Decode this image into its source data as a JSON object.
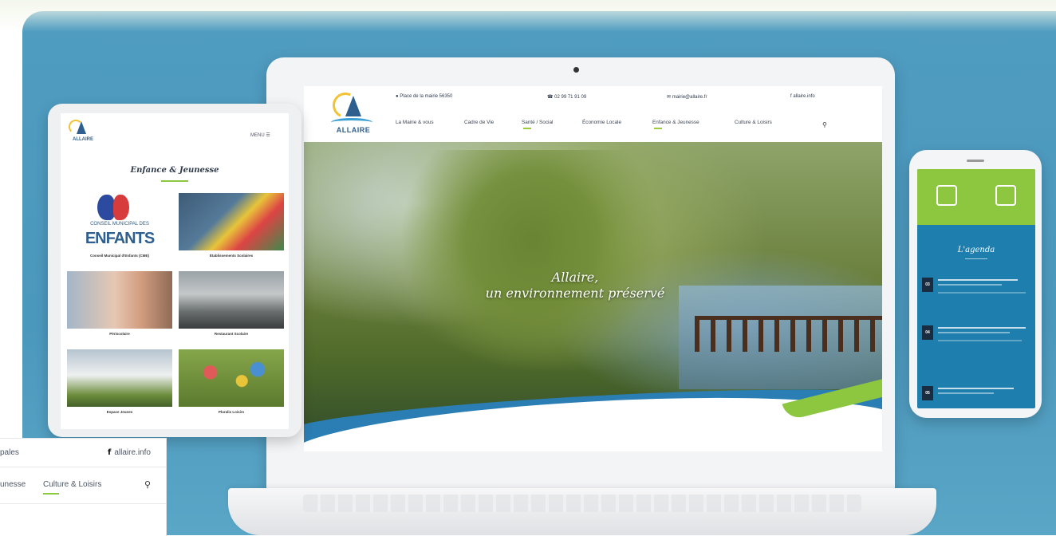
{
  "colors": {
    "backdrop": "#4f9cc0",
    "accent_green": "#8dc63f",
    "brand_blue": "#2e5f8e"
  },
  "laptop": {
    "topbar": {
      "address": "Place de la mairie 56350",
      "phone": "02 99 71 91 09",
      "email": "mairie@allaire.fr",
      "facebook": "allaire.info"
    },
    "nav": [
      "La Mairie & vous",
      "Cadre de Vie",
      "Santé / Social",
      "Économie Locale",
      "Enfance & Jeunesse",
      "Culture & Loisirs"
    ],
    "logo_text": "ALLAIRE",
    "hero_line1": "Allaire,",
    "hero_line2": "un environnement préservé"
  },
  "tablet": {
    "menu_label": "MENU",
    "title": "Enfance & Jeunesse",
    "enfants_pre": "CONSEIL MUNICIPAL DES",
    "enfants_big": "ENFANTS",
    "tiles": [
      "Conseil Municipal d'Enfants (CME)",
      "Établissements Scolaires",
      "Périscolaire",
      "Restaurant Scolaire",
      "Espace Jeunes",
      "Pluralis Loisirs"
    ]
  },
  "phone": {
    "agenda_title": "L'agenda",
    "dates": [
      "03",
      "04",
      "05"
    ]
  },
  "overlay": {
    "row1_left": "pales",
    "facebook_glyph": "f",
    "facebook_text": "allaire.info",
    "row2_left": "unesse",
    "row2_active": "Culture & Loisirs"
  }
}
